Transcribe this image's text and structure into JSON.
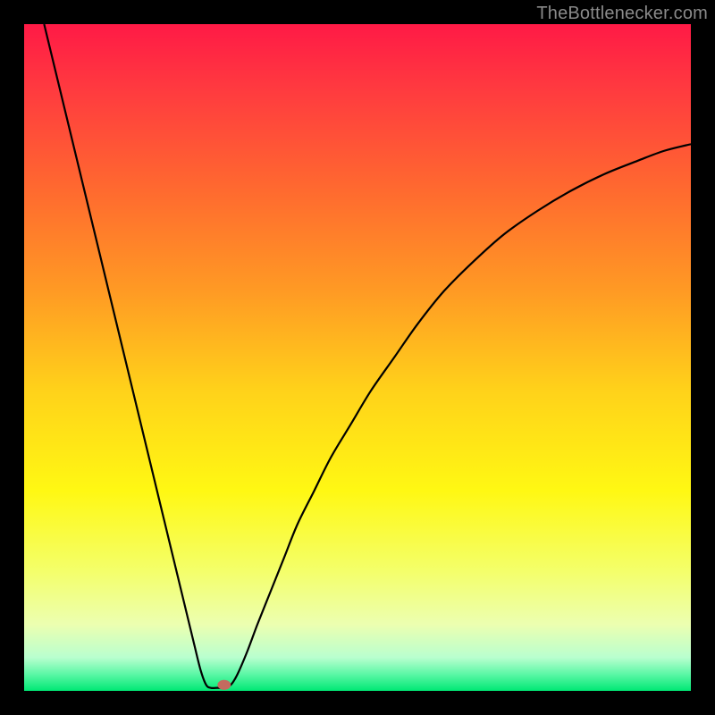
{
  "watermark": "TheBottlenecker.com",
  "chart_data": {
    "type": "line",
    "title": "",
    "xlabel": "",
    "ylabel": "",
    "xlim": [
      0,
      100
    ],
    "ylim": [
      0,
      100
    ],
    "background_gradient": {
      "stops": [
        {
          "offset": 0.0,
          "color": "#ff1a46"
        },
        {
          "offset": 0.1,
          "color": "#ff3b3f"
        },
        {
          "offset": 0.25,
          "color": "#ff6a2f"
        },
        {
          "offset": 0.4,
          "color": "#ff9a24"
        },
        {
          "offset": 0.55,
          "color": "#ffd21a"
        },
        {
          "offset": 0.7,
          "color": "#fff813"
        },
        {
          "offset": 0.82,
          "color": "#f4ff6a"
        },
        {
          "offset": 0.9,
          "color": "#ecffb0"
        },
        {
          "offset": 0.95,
          "color": "#b9ffcf"
        },
        {
          "offset": 0.975,
          "color": "#5cf7a6"
        },
        {
          "offset": 1.0,
          "color": "#00e874"
        }
      ]
    },
    "series": [
      {
        "name": "bottleneck-curve",
        "color": "#000000",
        "width": 2.2,
        "points": [
          [
            3.0,
            100.0
          ],
          [
            4.5,
            93.8
          ],
          [
            6.0,
            87.6
          ],
          [
            7.5,
            81.4
          ],
          [
            9.0,
            75.2
          ],
          [
            10.5,
            69.0
          ],
          [
            12.0,
            62.8
          ],
          [
            13.5,
            56.6
          ],
          [
            15.0,
            50.4
          ],
          [
            16.5,
            44.2
          ],
          [
            18.0,
            38.0
          ],
          [
            19.5,
            31.8
          ],
          [
            21.0,
            25.6
          ],
          [
            22.5,
            19.4
          ],
          [
            24.0,
            13.2
          ],
          [
            25.5,
            7.0
          ],
          [
            26.5,
            3.0
          ],
          [
            27.3,
            0.9
          ],
          [
            28.0,
            0.45
          ],
          [
            29.0,
            0.45
          ],
          [
            30.0,
            0.45
          ],
          [
            31.0,
            0.9
          ],
          [
            32.0,
            2.5
          ],
          [
            33.5,
            6.0
          ],
          [
            35.0,
            10.0
          ],
          [
            37.0,
            15.0
          ],
          [
            39.0,
            20.0
          ],
          [
            41.0,
            25.0
          ],
          [
            43.5,
            30.0
          ],
          [
            46.0,
            35.0
          ],
          [
            49.0,
            40.0
          ],
          [
            52.0,
            45.0
          ],
          [
            55.5,
            50.0
          ],
          [
            59.0,
            55.0
          ],
          [
            63.0,
            60.0
          ],
          [
            67.5,
            64.5
          ],
          [
            72.0,
            68.5
          ],
          [
            77.0,
            72.0
          ],
          [
            82.0,
            75.0
          ],
          [
            87.0,
            77.5
          ],
          [
            92.0,
            79.5
          ],
          [
            96.0,
            81.0
          ],
          [
            100.0,
            82.0
          ]
        ]
      }
    ],
    "marker": {
      "name": "optimal-point",
      "x": 30.0,
      "y": 0.9,
      "rx": 1.0,
      "ry": 0.75,
      "color": "#c46a5f"
    }
  }
}
